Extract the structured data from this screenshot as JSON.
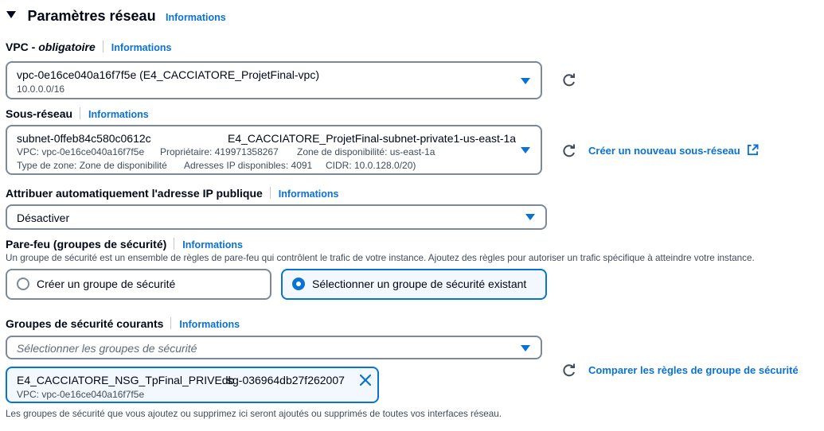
{
  "section": {
    "title": "Paramètres réseau",
    "info": "Informations"
  },
  "vpc": {
    "label": "VPC - ",
    "label_em": "obligatoire",
    "info": "Informations",
    "value": "vpc-0e16ce040a16f7f5e (E4_CACCIATORE_ProjetFinal-vpc)",
    "cidr": "10.0.0.0/16"
  },
  "subnet": {
    "label": "Sous-réseau",
    "info": "Informations",
    "id": "subnet-0ffeb84c580c0612c",
    "name": "E4_CACCIATORE_ProjetFinal-subnet-private1-us-east-1a",
    "vpc": "VPC: vpc-0e16ce040a16f7f5e",
    "owner": "Propriétaire: 419971358267",
    "az": "Zone de disponibilité: us-east-1a",
    "zone_type": "Type de zone: Zone de disponibilité",
    "ips": "Adresses IP disponibles: 4091",
    "cidr": "CIDR: 10.0.128.0/20)",
    "create_link": "Créer un nouveau sous-réseau"
  },
  "public_ip": {
    "label": "Attribuer automatiquement l'adresse IP publique",
    "info": "Informations",
    "value": "Désactiver"
  },
  "firewall": {
    "label": "Pare-feu (groupes de sécurité)",
    "info": "Informations",
    "description": "Un groupe de sécurité est un ensemble de règles de pare-feu qui contrôlent le trafic de votre instance. Ajoutez des règles pour autoriser un trafic spécifique à atteindre votre instance.",
    "option_create": "Créer un groupe de sécurité",
    "option_select": "Sélectionner un groupe de sécurité existant",
    "selected": "option_select"
  },
  "current_sg": {
    "label": "Groupes de sécurité courants",
    "info": "Informations",
    "placeholder": "Sélectionner les groupes de sécurité",
    "token_name": "E4_CACCIATORE_NSG_TpFinal_PRIVEdb",
    "token_id": "sg-036964db27f262007",
    "token_vpc": "VPC: vpc-0e16ce040a16f7f5e",
    "compare_link": "Comparer les règles de groupe de sécurité",
    "footer": "Les groupes de sécurité que vous ajoutez ou supprimez ici seront ajoutés ou supprimés de toutes vos interfaces réseau."
  },
  "colors": {
    "accent": "#0972d3",
    "text": "#000716",
    "secondary_text": "#414d5c",
    "border": "#7d8998"
  }
}
